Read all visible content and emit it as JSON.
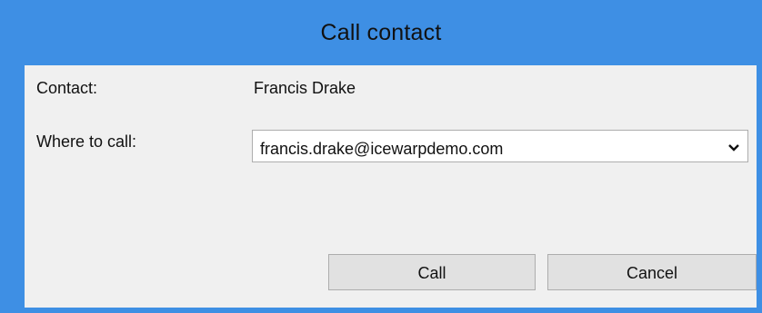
{
  "window": {
    "title": "Call contact",
    "accent_color": "#3e8fe4",
    "client_background": "#f0f0f0"
  },
  "form": {
    "contact_label": "Contact:",
    "contact_value": "Francis Drake",
    "where_label": "Where to call:",
    "where_value": "francis.drake@icewarpdemo.com",
    "dropdown_icon": "chevron-down-icon"
  },
  "buttons": {
    "call_label": "Call",
    "cancel_label": "Cancel"
  }
}
